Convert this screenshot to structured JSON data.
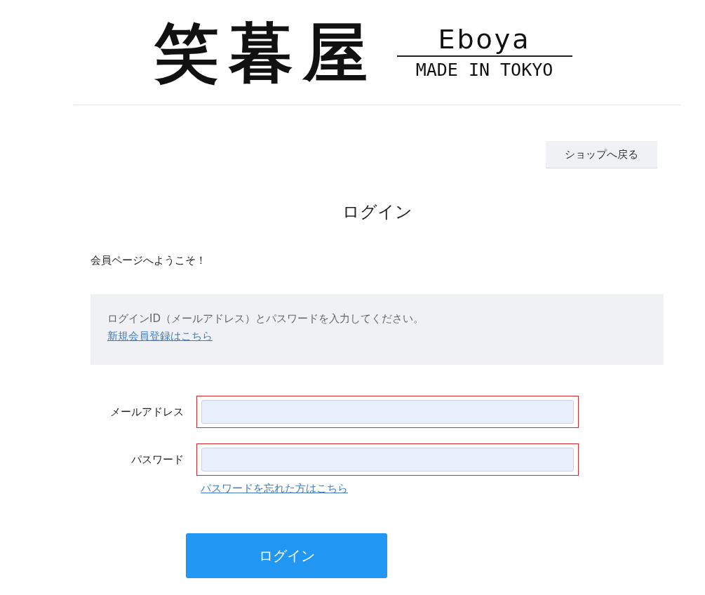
{
  "logo": {
    "kanji": "笑暮屋",
    "name": "Eboya",
    "tagline": "MADE IN TOKYO"
  },
  "back_button": "ショップへ戻る",
  "title": "ログイン",
  "welcome": "会員ページへようこそ！",
  "notice": {
    "text": "ログインID（メールアドレス）とパスワードを入力してください。",
    "link": "新規会員登録はこちら"
  },
  "fields": [
    {
      "label": "メールアドレス",
      "highlighted": true
    },
    {
      "label": "パスワード",
      "highlighted": true
    }
  ],
  "forgot_link": "パスワードを忘れた方はこちら",
  "submit_button": "ログイン"
}
